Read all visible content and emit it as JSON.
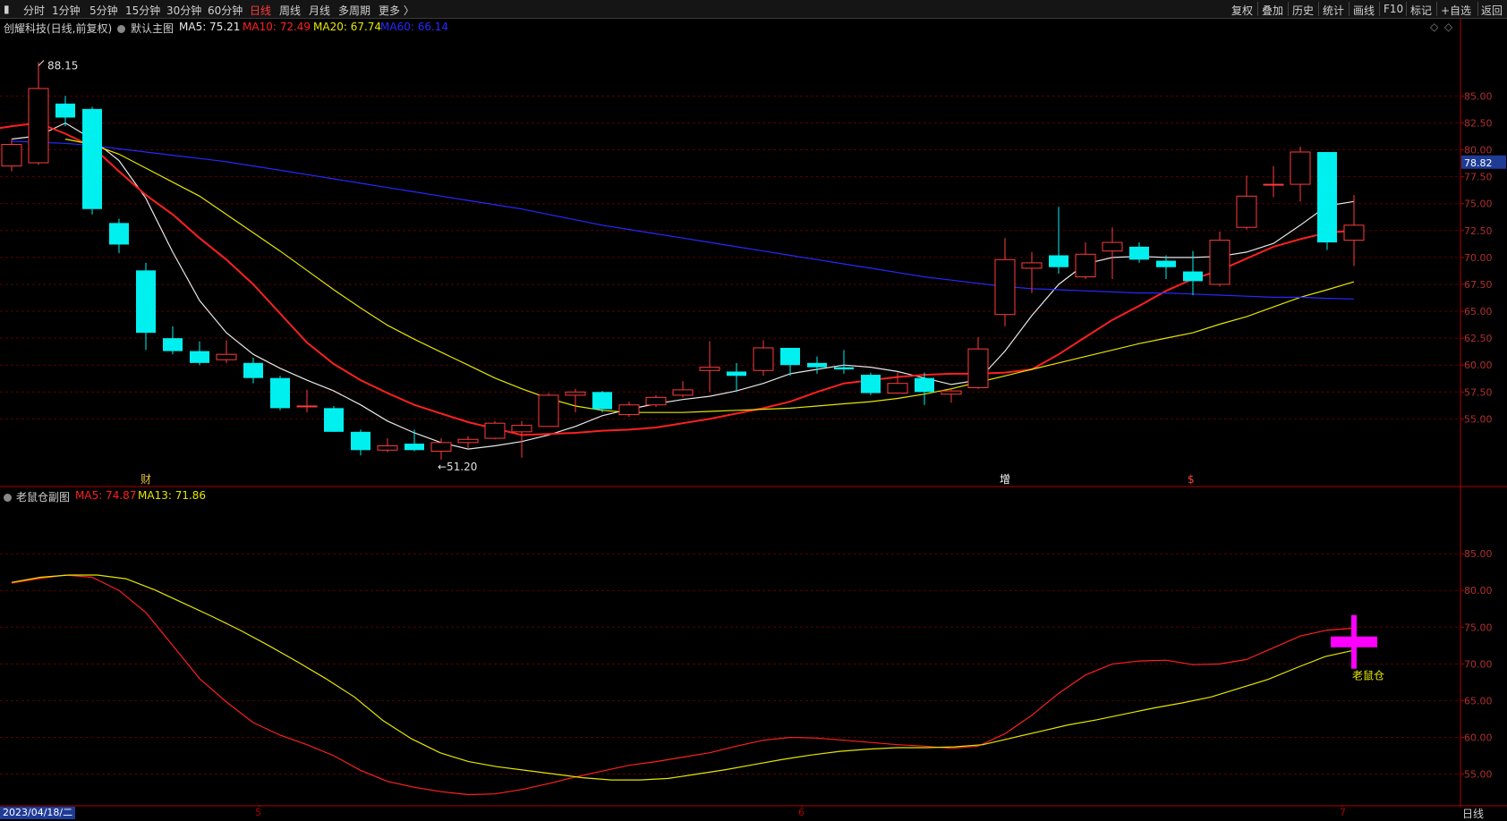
{
  "toolbar": {
    "periods": [
      "分时",
      "1分钟",
      "5分钟",
      "15分钟",
      "30分钟",
      "60分钟",
      "日线",
      "周线",
      "月线",
      "多周期",
      "更多 〉"
    ],
    "active_period": "日线",
    "tools": [
      "复权",
      "叠加",
      "历史",
      "统计",
      "画线",
      "F10",
      "标记",
      "+自选",
      "返回"
    ]
  },
  "main_legend": {
    "stock": "创耀科技(日线,前复权)",
    "chart_name": "默认主图",
    "ma5": "MA5: 75.21",
    "ma10": "MA10: 72.49",
    "ma20": "MA20: 67.74",
    "ma60": "MA60: 66.14"
  },
  "sub_legend": {
    "chart_name": "老鼠仓副图",
    "ma5": "MA5: 74.87",
    "ma13": "MA13: 71.86"
  },
  "bottom": {
    "date": "2023/04/18/二",
    "month_ticks": [
      "5",
      "6",
      "7"
    ],
    "tab": "日线"
  },
  "colors": {
    "up": "#ff3b3b",
    "down": "#00f0f0",
    "ma5": "#e8e8e8",
    "ma10": "#ff2020",
    "ma20": "#e6e600",
    "ma60": "#2828ff",
    "grid": "#5a0000",
    "axis": "#b00000",
    "marker": "#ff00ff",
    "price_tag": "#1e3c96"
  },
  "chart_data": [
    {
      "type": "candlestick",
      "title": "创耀科技(日线,前复权)",
      "y_ticks": [
        85.0,
        82.5,
        80.0,
        77.5,
        75.0,
        72.5,
        70.0,
        67.5,
        65.0,
        62.5,
        60.0,
        57.5,
        55.0
      ],
      "ylim": [
        48.8,
        90.6
      ],
      "last_price": "78.82",
      "annotations": {
        "high": "88.15",
        "low": "←51.20",
        "markers": [
          "财",
          "增",
          "$"
        ]
      },
      "candles": [
        {
          "o": 78.5,
          "c": 80.5,
          "h": 81.0,
          "l": 78.0
        },
        {
          "o": 78.8,
          "c": 85.7,
          "h": 88.15,
          "l": 78.6
        },
        {
          "o": 84.3,
          "c": 83.0,
          "h": 85.0,
          "l": 82.2
        },
        {
          "o": 83.8,
          "c": 74.5,
          "h": 84.0,
          "l": 74.0
        },
        {
          "o": 73.2,
          "c": 71.2,
          "h": 73.6,
          "l": 70.4
        },
        {
          "o": 68.8,
          "c": 63.0,
          "h": 69.5,
          "l": 61.4
        },
        {
          "o": 62.5,
          "c": 61.3,
          "h": 63.6,
          "l": 61.0
        },
        {
          "o": 61.3,
          "c": 60.2,
          "h": 62.2,
          "l": 60.0
        },
        {
          "o": 60.5,
          "c": 61.0,
          "h": 62.3,
          "l": 60.2
        },
        {
          "o": 60.2,
          "c": 58.8,
          "h": 60.7,
          "l": 58.3
        },
        {
          "o": 58.8,
          "c": 56.0,
          "h": 59.0,
          "l": 55.8
        },
        {
          "o": 56.2,
          "c": 56.2,
          "h": 57.7,
          "l": 55.6
        },
        {
          "o": 56.0,
          "c": 53.8,
          "h": 56.2,
          "l": 53.8
        },
        {
          "o": 53.8,
          "c": 52.1,
          "h": 54.0,
          "l": 51.6
        },
        {
          "o": 52.1,
          "c": 52.5,
          "h": 53.2,
          "l": 51.9
        },
        {
          "o": 52.7,
          "c": 52.1,
          "h": 54.0,
          "l": 52.0
        },
        {
          "o": 52.0,
          "c": 52.8,
          "h": 53.2,
          "l": 51.2
        },
        {
          "o": 52.8,
          "c": 53.1,
          "h": 53.4,
          "l": 52.3
        },
        {
          "o": 53.2,
          "c": 54.6,
          "h": 54.8,
          "l": 53.1
        },
        {
          "o": 53.8,
          "c": 54.4,
          "h": 54.8,
          "l": 51.4
        },
        {
          "o": 54.3,
          "c": 57.2,
          "h": 57.4,
          "l": 54.3
        },
        {
          "o": 57.2,
          "c": 57.5,
          "h": 57.8,
          "l": 55.6
        },
        {
          "o": 57.5,
          "c": 55.9,
          "h": 57.6,
          "l": 55.6
        },
        {
          "o": 55.4,
          "c": 56.3,
          "h": 56.6,
          "l": 55.2
        },
        {
          "o": 56.3,
          "c": 57.0,
          "h": 57.2,
          "l": 56.1
        },
        {
          "o": 57.2,
          "c": 57.7,
          "h": 58.5,
          "l": 57.0
        },
        {
          "o": 59.5,
          "c": 59.8,
          "h": 62.2,
          "l": 57.5
        },
        {
          "o": 59.4,
          "c": 59.0,
          "h": 60.2,
          "l": 57.6
        },
        {
          "o": 59.5,
          "c": 61.6,
          "h": 62.3,
          "l": 59.0
        },
        {
          "o": 61.6,
          "c": 60.0,
          "h": 61.6,
          "l": 59.0
        },
        {
          "o": 60.2,
          "c": 59.8,
          "h": 60.8,
          "l": 59.2
        },
        {
          "o": 59.8,
          "c": 59.6,
          "h": 61.4,
          "l": 59.2
        },
        {
          "o": 59.1,
          "c": 57.4,
          "h": 59.3,
          "l": 57.2
        },
        {
          "o": 57.4,
          "c": 58.3,
          "h": 59.3,
          "l": 57.4
        },
        {
          "o": 58.8,
          "c": 57.5,
          "h": 59.3,
          "l": 56.3
        },
        {
          "o": 57.3,
          "c": 57.6,
          "h": 57.8,
          "l": 56.5
        },
        {
          "o": 57.9,
          "c": 61.5,
          "h": 62.6,
          "l": 57.8
        },
        {
          "o": 64.7,
          "c": 69.8,
          "h": 71.8,
          "l": 63.6
        },
        {
          "o": 69.0,
          "c": 69.5,
          "h": 70.5,
          "l": 66.7
        },
        {
          "o": 70.2,
          "c": 69.1,
          "h": 74.7,
          "l": 68.5
        },
        {
          "o": 68.2,
          "c": 70.3,
          "h": 71.4,
          "l": 68.0
        },
        {
          "o": 70.6,
          "c": 71.4,
          "h": 72.8,
          "l": 68.0
        },
        {
          "o": 71.0,
          "c": 69.8,
          "h": 71.4,
          "l": 69.5
        },
        {
          "o": 69.7,
          "c": 69.1,
          "h": 70.2,
          "l": 68.0
        },
        {
          "o": 68.7,
          "c": 67.8,
          "h": 70.6,
          "l": 66.5
        },
        {
          "o": 67.5,
          "c": 71.6,
          "h": 72.4,
          "l": 67.3
        },
        {
          "o": 72.8,
          "c": 75.7,
          "h": 77.6,
          "l": 72.6
        },
        {
          "o": 76.8,
          "c": 76.8,
          "h": 78.5,
          "l": 75.6
        },
        {
          "o": 76.8,
          "c": 79.8,
          "h": 80.3,
          "l": 75.2
        },
        {
          "o": 79.8,
          "c": 71.4,
          "h": 79.8,
          "l": 70.7
        },
        {
          "o": 71.6,
          "c": 73.0,
          "h": 75.8,
          "l": 69.2
        }
      ],
      "series": [
        {
          "name": "MA5",
          "values": [
            81.0,
            81.3,
            82.5,
            81.0,
            79.0,
            75.5,
            70.5,
            66.0,
            63.0,
            61.0,
            59.7,
            58.6,
            57.6,
            56.3,
            54.8,
            53.7,
            52.8,
            52.2,
            52.5,
            52.9,
            53.5,
            54.3,
            55.3,
            55.9,
            56.4,
            56.8,
            57.1,
            57.6,
            58.3,
            59.2,
            59.6,
            60.0,
            59.8,
            59.4,
            58.8,
            58.2,
            58.6,
            61.3,
            64.6,
            67.5,
            69.4,
            70.0,
            70.1,
            70.0,
            70.0,
            70.1,
            70.5,
            71.3,
            73.0,
            74.8,
            75.2
          ]
        },
        {
          "name": "MA10",
          "values": [
            81.8,
            82.2,
            82.5,
            81.5,
            80.3,
            78.0,
            75.8,
            74.0,
            71.8,
            69.8,
            67.5,
            64.8,
            62.1,
            60.1,
            58.6,
            57.4,
            56.3,
            55.5,
            54.7,
            54.1,
            53.5,
            53.6,
            53.7,
            53.9,
            54.0,
            54.2,
            54.6,
            55.0,
            55.5,
            56.0,
            56.6,
            57.5,
            58.3,
            58.6,
            58.9,
            59.1,
            59.2,
            59.2,
            59.3,
            59.6,
            61.0,
            62.6,
            64.2,
            65.5,
            66.9,
            68.0,
            68.8,
            69.9,
            71.0,
            71.7,
            72.3,
            72.5
          ]
        },
        {
          "name": "MA20",
          "values": [
            null,
            null,
            null,
            81.0,
            80.5,
            79.6,
            78.3,
            77.0,
            75.7,
            74.0,
            72.3,
            70.6,
            68.8,
            67.0,
            65.3,
            63.7,
            62.4,
            61.2,
            60.0,
            58.8,
            57.8,
            56.9,
            56.2,
            55.8,
            55.6,
            55.6,
            55.6,
            55.7,
            55.8,
            55.9,
            56.0,
            56.2,
            56.4,
            56.6,
            56.9,
            57.3,
            57.8,
            58.4,
            59.0,
            59.6,
            60.2,
            60.8,
            61.4,
            62.0,
            62.5,
            63.0,
            63.8,
            64.5,
            65.4,
            66.3,
            67.0,
            67.74
          ]
        },
        {
          "name": "MA60",
          "values": [
            80.8,
            80.7,
            80.6,
            80.4,
            80.1,
            79.8,
            79.5,
            79.2,
            78.9,
            78.5,
            78.1,
            77.7,
            77.3,
            76.9,
            76.5,
            76.1,
            75.7,
            75.3,
            74.9,
            74.5,
            74.0,
            73.5,
            73.0,
            72.6,
            72.2,
            71.8,
            71.4,
            71.0,
            70.6,
            70.2,
            69.8,
            69.4,
            69.0,
            68.6,
            68.2,
            67.9,
            67.6,
            67.3,
            67.1,
            67.0,
            66.9,
            66.8,
            66.7,
            66.7,
            66.6,
            66.5,
            66.4,
            66.3,
            66.3,
            66.2,
            66.14
          ]
        }
      ]
    },
    {
      "type": "line",
      "title": "老鼠仓副图",
      "y_ticks": [
        85.0,
        80.0,
        75.0,
        70.0,
        65.0,
        60.0,
        55.0
      ],
      "ylim": [
        50.8,
        91.6
      ],
      "signal": {
        "label": "老鼠仓",
        "value": 73.0
      },
      "series": [
        {
          "name": "MA5",
          "values": [
            81.0,
            81.6,
            82.1,
            81.8,
            80.0,
            77.0,
            72.5,
            68.0,
            64.8,
            62.0,
            60.3,
            59.0,
            57.5,
            55.5,
            54.0,
            53.2,
            52.6,
            52.2,
            52.3,
            52.9,
            53.7,
            54.6,
            55.4,
            56.2,
            56.7,
            57.3,
            57.9,
            58.8,
            59.6,
            60.0,
            59.9,
            59.6,
            59.3,
            59.0,
            58.8,
            58.5,
            58.8,
            60.5,
            63.0,
            66.0,
            68.5,
            70.0,
            70.4,
            70.5,
            69.9,
            70.0,
            70.6,
            72.2,
            73.8,
            74.6,
            74.87
          ]
        },
        {
          "name": "MA13",
          "values": [
            81.1,
            81.8,
            82.1,
            82.1,
            81.6,
            80.1,
            78.3,
            76.5,
            74.6,
            72.5,
            70.3,
            68.0,
            65.5,
            62.3,
            59.8,
            57.9,
            56.7,
            56.0,
            55.5,
            55.0,
            54.5,
            54.2,
            54.2,
            54.4,
            55.0,
            55.6,
            56.3,
            57.0,
            57.6,
            58.1,
            58.4,
            58.6,
            58.6,
            58.7,
            59.0,
            59.9,
            60.8,
            61.7,
            62.4,
            63.2,
            64.0,
            64.7,
            65.5,
            66.7,
            67.9,
            69.5,
            71.0,
            71.86
          ]
        }
      ]
    }
  ]
}
